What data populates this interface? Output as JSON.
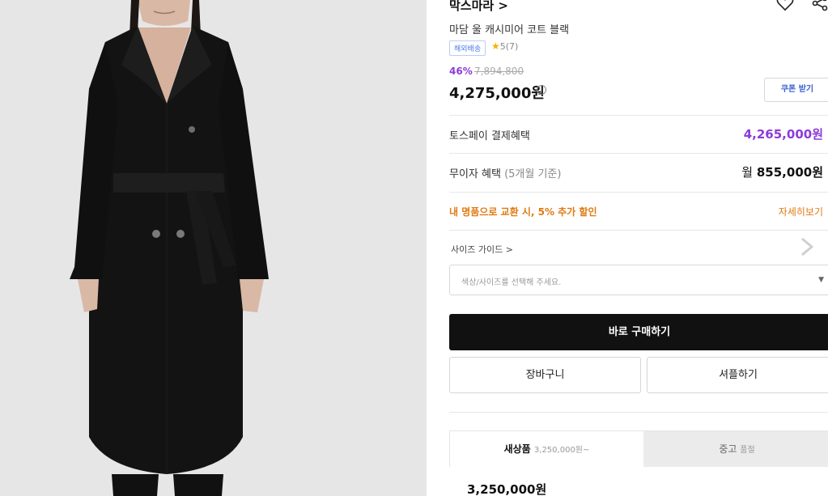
{
  "product": {
    "brand": "막스마라 >",
    "name": "마담 울 캐시미어 코트 블랙",
    "shipping_badge": "해외배송",
    "rating_star": "★",
    "rating_text": "5(7)",
    "discount_rate": "46%",
    "original_price": "7,894,800",
    "price": "4,275,000원",
    "price_info_icon": "i",
    "coupon_button": "쿠폰 받기"
  },
  "benefits": {
    "toss_label": "토스페이 결제혜택",
    "toss_value": "4,265,000원",
    "nointerest_label": "무이자 혜택",
    "nointerest_sub": "(5개월 기준)",
    "nointerest_prefix": "월",
    "nointerest_value": "855,000원",
    "exchange_label": "내 명품으로 교환 시, 5% 추가 할인",
    "exchange_link": "자세히보기"
  },
  "options": {
    "size_guide": "사이즈 가이드 >",
    "select_placeholder": "색상/사이즈를 선택해 주세요.",
    "select_caret": "▼"
  },
  "actions": {
    "buy_now": "바로 구매하기",
    "cart": "장바구니",
    "shuffle": "셔플하기"
  },
  "tabs": {
    "new_label": "새상품",
    "new_sub": "3,250,000원~",
    "used_label": "중고",
    "used_sub": "품절"
  },
  "bottom_price": "3,250,000원",
  "icons": {
    "heart": "heart-icon",
    "share": "share-icon",
    "chevron": "chevron-right-icon"
  },
  "colors": {
    "accent_purple": "#8c3bd9",
    "accent_orange": "#e07a12",
    "buy_button": "#111111"
  }
}
